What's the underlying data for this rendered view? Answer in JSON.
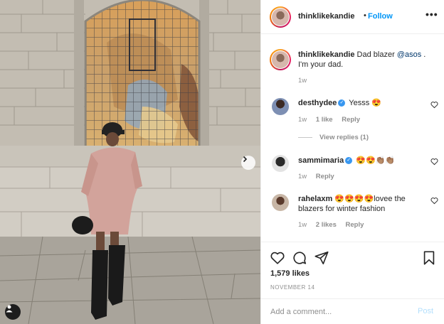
{
  "post": {
    "username": "thinklikekandie",
    "follow_label": "Follow",
    "more_label": "•••"
  },
  "caption": {
    "username": "thinklikekandie",
    "text_before": "Dad blazer ",
    "mention": "@asos",
    "text_after": " . I'm your dad.",
    "time": "1w"
  },
  "comments": [
    {
      "username": "desthydee",
      "verified": true,
      "text": "Yesss 😍",
      "time": "1w",
      "likes": "1 like",
      "reply": "Reply",
      "view_replies": "View replies (1)"
    },
    {
      "username": "sammimaria",
      "verified": true,
      "text": "😍😍👏🏽👏🏽",
      "time": "1w",
      "reply": "Reply"
    },
    {
      "username": "rahelaxm",
      "verified": false,
      "text": "😍😍😍😍lovee the blazers for winter fashion",
      "time": "1w",
      "likes": "2 likes",
      "reply": "Reply"
    }
  ],
  "footer": {
    "likes": "1,579 likes",
    "date": "NOVEMBER 14",
    "add_comment_placeholder": "Add a comment...",
    "post_label": "Post"
  },
  "colors": {
    "follow_blue": "#0095f6",
    "post_disabled": "#b2dffc",
    "verified": "#3897f0"
  },
  "icons": [
    "heart-icon",
    "comment-icon",
    "share-icon",
    "bookmark-icon",
    "more-icon",
    "chevron-right-icon",
    "user-tag-icon",
    "verified-icon"
  ]
}
